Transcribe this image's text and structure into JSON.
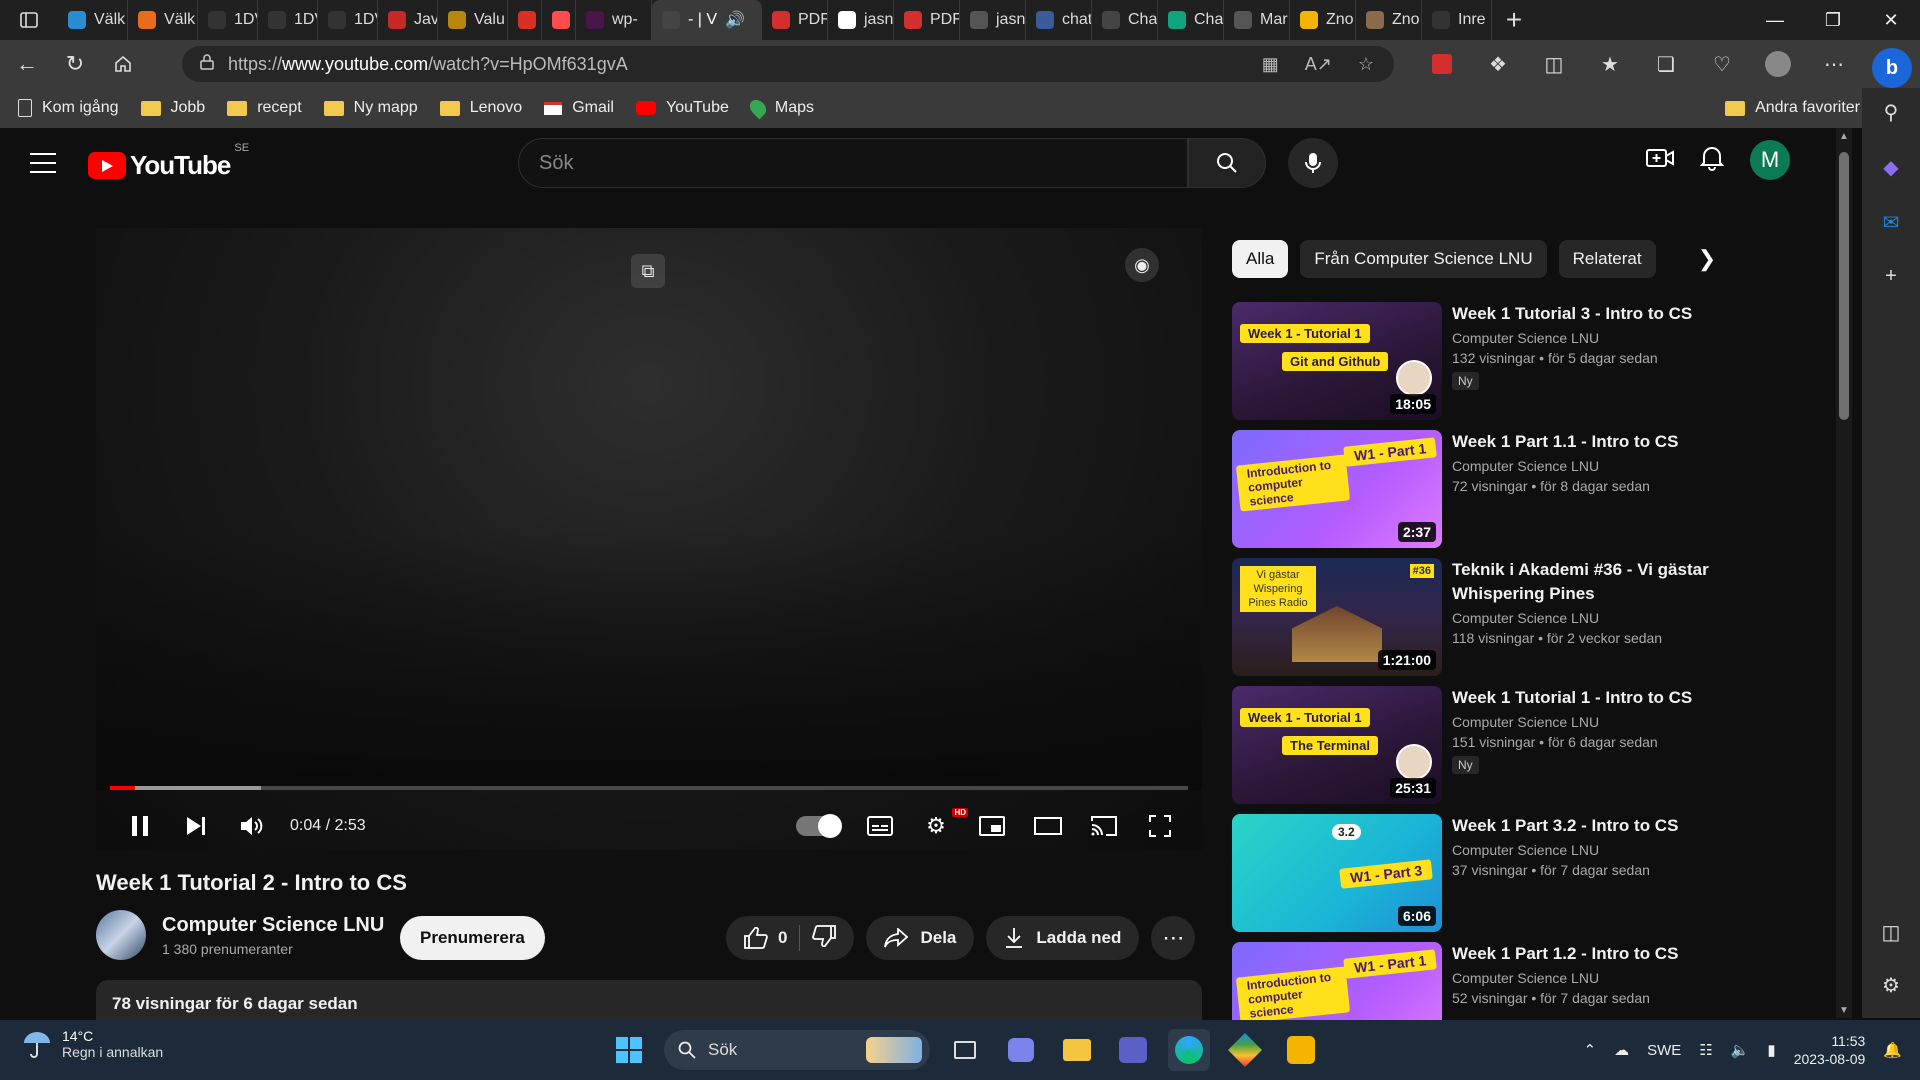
{
  "browser": {
    "tabs": [
      {
        "label": "Välk",
        "color": "#2a8dd4"
      },
      {
        "label": "Välk",
        "color": "#e86c1a"
      },
      {
        "label": "1DV",
        "color": "#333333"
      },
      {
        "label": "1DV",
        "color": "#333333"
      },
      {
        "label": "1DV",
        "color": "#333333"
      },
      {
        "label": "Java",
        "color": "#c62828"
      },
      {
        "label": "Valu",
        "color": "#b8860b"
      },
      {
        "label": "",
        "color": "#d93025"
      },
      {
        "label": "",
        "color": "#ff4d4d"
      },
      {
        "label": "wp-",
        "color": "#4a154b"
      },
      {
        "label": "- | V",
        "color": "#444444"
      },
      {
        "label": "PDF",
        "color": "#d32f2f"
      },
      {
        "label": "jasn",
        "color": "#ffffff"
      },
      {
        "label": "PDF",
        "color": "#d32f2f"
      },
      {
        "label": "jasn",
        "color": "#555555"
      },
      {
        "label": "chat",
        "color": "#3a5a9a"
      },
      {
        "label": "Cha",
        "color": "#444444"
      },
      {
        "label": "Cha",
        "color": "#10a37f"
      },
      {
        "label": "Mar",
        "color": "#555555"
      },
      {
        "label": "Zno",
        "color": "#f5b400"
      },
      {
        "label": "Zno",
        "color": "#8a6a4a"
      },
      {
        "label": "Inre",
        "color": "#333333"
      }
    ],
    "active_tab_index": 10,
    "url_prefix": "https://",
    "url_domain": "www.youtube.com",
    "url_path": "/watch?v=HpOMf631gvA",
    "favorites": [
      {
        "label": "Kom igång",
        "icon": "page-icon"
      },
      {
        "label": "Jobb",
        "icon": "folder-icon"
      },
      {
        "label": "recept",
        "icon": "folder-icon"
      },
      {
        "label": "Ny mapp",
        "icon": "folder-icon"
      },
      {
        "label": "Lenovo",
        "icon": "folder-icon"
      },
      {
        "label": "Gmail",
        "icon": "gmail-icon"
      },
      {
        "label": "YouTube",
        "icon": "youtube-icon"
      },
      {
        "label": "Maps",
        "icon": "maps-icon"
      }
    ],
    "other_favorites": "Andra favoriter"
  },
  "youtube": {
    "logo_text": "YouTube",
    "country_code": "SE",
    "search_placeholder": "Sök",
    "avatar_letter": "M",
    "avatar_color": "#0b7a55",
    "brand_red": "#ff0000"
  },
  "player": {
    "current_time": "0:04",
    "duration": "2:53",
    "time_display": "0:04 / 2:53",
    "played_fraction": 0.023,
    "buffered_fraction": 0.14,
    "hd_badge": "HD"
  },
  "video": {
    "title": "Week 1 Tutorial 2 - Intro to CS",
    "channel": "Computer Science LNU",
    "subscribers": "1 380 prenumeranter",
    "subscribe_label": "Prenumerera",
    "likes": "0",
    "share_label": "Dela",
    "download_label": "Ladda ned",
    "views_date": "78 visningar  för 6 dagar sedan"
  },
  "chips": [
    "Alla",
    "Från Computer Science LNU",
    "Relaterat"
  ],
  "recommendations": [
    {
      "title": "Week 1 Tutorial 3 - Intro to CS",
      "channel": "Computer Science LNU",
      "stats": "132 visningar  • för 5 dagar sedan",
      "duration": "18:05",
      "badge": "Ny",
      "thumb_line1": "Week 1 - Tutorial 1",
      "thumb_line2": "Git and Github",
      "thumb_style": "tutorial"
    },
    {
      "title": "Week 1 Part 1.1 - Intro to CS",
      "channel": "Computer Science LNU",
      "stats": "72 visningar  • för 8 dagar sedan",
      "duration": "2:37",
      "badge": "",
      "thumb_line1": "Introduction to computer science",
      "thumb_line2": "W1 - Part 1",
      "thumb_style": "part"
    },
    {
      "title": "Teknik i Akademi #36 - Vi gästar Whispering Pines",
      "channel": "Computer Science LNU",
      "stats": "118 visningar  • för 2 veckor sedan",
      "duration": "1:21:00",
      "badge": "",
      "thumb_line1": "Vi gästar Wispering Pines Radio",
      "thumb_line2": "#36",
      "thumb_style": "photo"
    },
    {
      "title": "Week 1 Tutorial 1 - Intro to CS",
      "channel": "Computer Science LNU",
      "stats": "151 visningar  • för 6 dagar sedan",
      "duration": "25:31",
      "badge": "Ny",
      "thumb_line1": "Week 1 - Tutorial 1",
      "thumb_line2": "The Terminal",
      "thumb_style": "tutorial"
    },
    {
      "title": "Week 1 Part 3.2 - Intro to CS",
      "channel": "Computer Science LNU",
      "stats": "37 visningar  • för 7 dagar sedan",
      "duration": "6:06",
      "badge": "",
      "thumb_line1": "3.2",
      "thumb_line2": "W1 - Part 3",
      "thumb_style": "part3"
    },
    {
      "title": "Week 1 Part 1.2 - Intro to CS",
      "channel": "Computer Science LNU",
      "stats": "52 visningar  • för 7 dagar sedan",
      "duration": "",
      "badge": "",
      "thumb_line1": "Introduction to computer science",
      "thumb_line2": "W1 - Part 1",
      "thumb_style": "part"
    }
  ],
  "taskbar": {
    "weather_temp": "14°C",
    "weather_desc": "Regn i annalkan",
    "search_label": "Sök",
    "language": "SWE",
    "time": "11:53",
    "date": "2023-08-09"
  }
}
